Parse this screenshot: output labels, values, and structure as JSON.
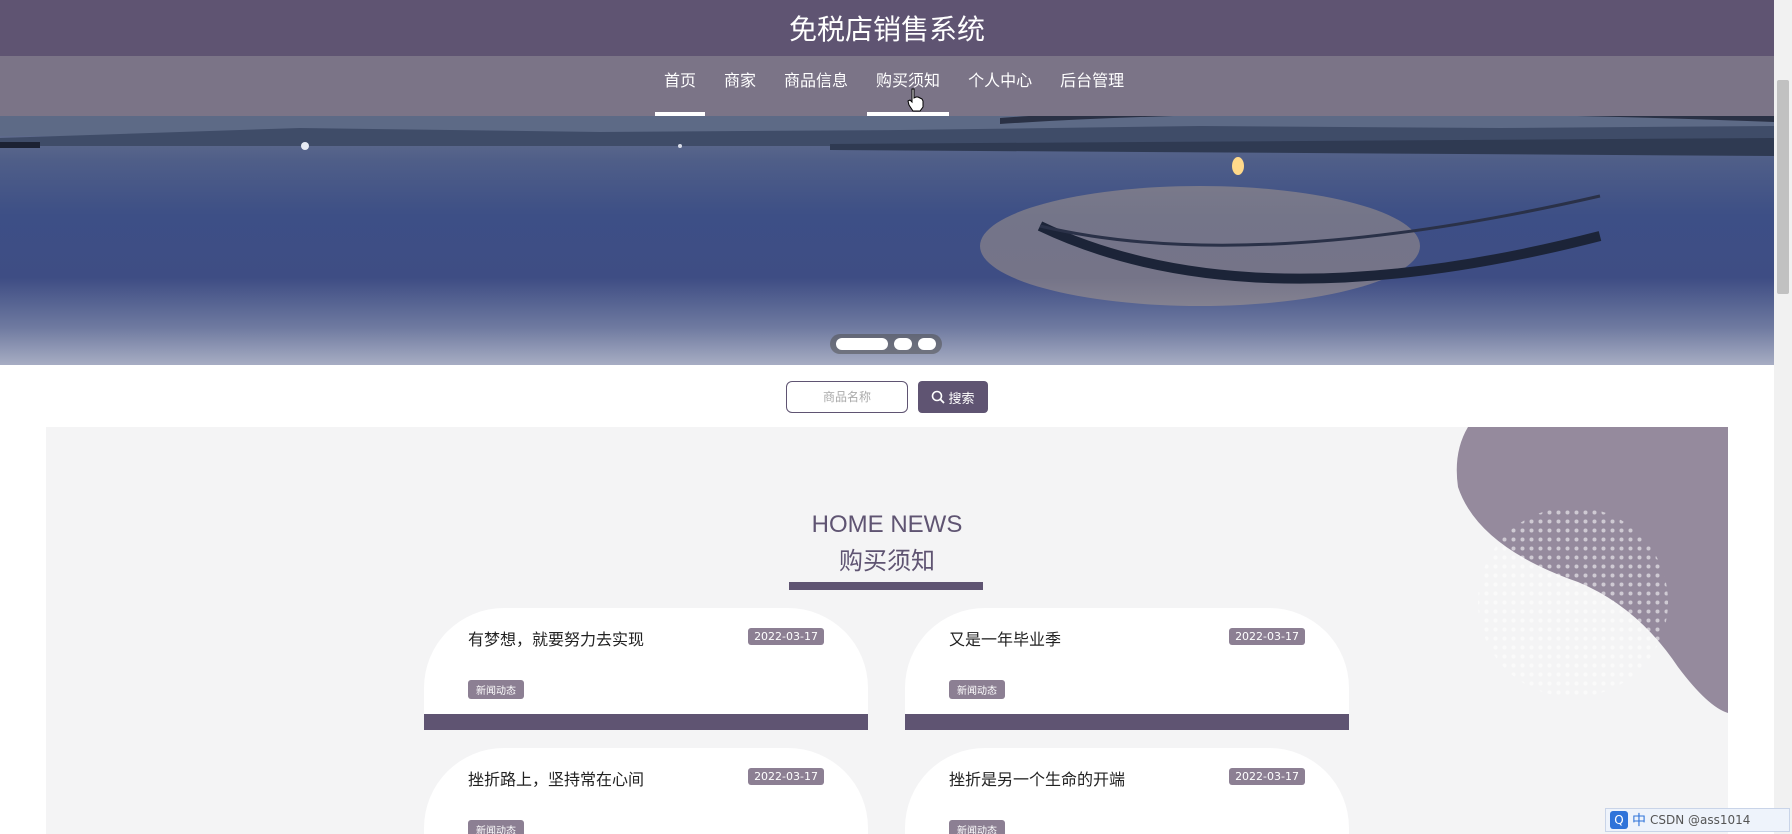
{
  "header": {
    "title": "免税店销售系统"
  },
  "nav": {
    "items": [
      {
        "label": "首页"
      },
      {
        "label": "商家"
      },
      {
        "label": "商品信息"
      },
      {
        "label": "购买须知"
      },
      {
        "label": "个人中心"
      },
      {
        "label": "后台管理"
      }
    ]
  },
  "search": {
    "placeholder": "商品名称",
    "button_label": "搜索"
  },
  "news": {
    "title_en": "HOME NEWS",
    "title_cn": "购买须知",
    "items": [
      {
        "title": "有梦想，就要努力去实现",
        "date": "2022-03-17",
        "tag": "新闻动态"
      },
      {
        "title": "又是一年毕业季",
        "date": "2022-03-17",
        "tag": "新闻动态"
      },
      {
        "title": "挫折路上，坚持常在心间",
        "date": "2022-03-17",
        "tag": "新闻动态"
      },
      {
        "title": "挫折是另一个生命的开端",
        "date": "2022-03-17",
        "tag": "新闻动态"
      }
    ]
  },
  "taskbar": {
    "ime_label": "中",
    "watermark": "CSDN @ass1014"
  },
  "colors": {
    "primary": "#5f5472",
    "nav_bg": "#7b7487",
    "tag_bg": "#8c7f93",
    "panel_bg": "#f4f4f5"
  }
}
